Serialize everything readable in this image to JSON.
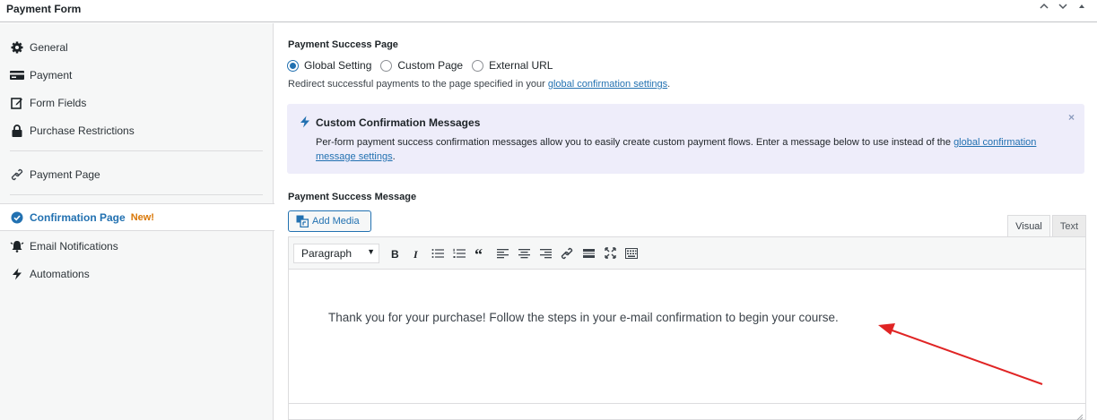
{
  "header": {
    "title": "Payment Form",
    "ctrl_up": "^",
    "ctrl_down": "v",
    "ctrl_collapse": "▴"
  },
  "sidebar": {
    "items": [
      {
        "label": "General",
        "icon": "gear-icon"
      },
      {
        "label": "Payment",
        "icon": "card-icon"
      },
      {
        "label": "Form Fields",
        "icon": "edit-icon"
      },
      {
        "label": "Purchase Restrictions",
        "icon": "lock-icon"
      },
      {
        "label": "Payment Page",
        "icon": "link-icon"
      },
      {
        "label": "Confirmation Page",
        "icon": "check-circle-icon",
        "badge": "New!",
        "active": true
      },
      {
        "label": "Email Notifications",
        "icon": "bell-icon"
      },
      {
        "label": "Automations",
        "icon": "bolt-icon"
      }
    ]
  },
  "success_page": {
    "label": "Payment Success Page",
    "options": [
      "Global Setting",
      "Custom Page",
      "External URL"
    ],
    "selected": "Global Setting",
    "help_prefix": "Redirect successful payments to the page specified in your ",
    "help_link": "global confirmation settings",
    "help_suffix": "."
  },
  "notice": {
    "title": "Custom Confirmation Messages",
    "body_prefix": "Per-form payment success confirmation messages allow you to easily create custom payment flows. Enter a message below to use instead of the ",
    "body_link": "global confirmation message settings",
    "body_suffix": ".",
    "close": "×"
  },
  "message": {
    "label": "Payment Success Message",
    "add_media": "Add Media",
    "tab_visual": "Visual",
    "tab_text": "Text",
    "format": "Paragraph",
    "content": "Thank you for your purchase! Follow the steps in your e-mail confirmation to begin your course."
  },
  "colors": {
    "accent": "#2271b1",
    "badge": "#d97706",
    "notice_bg": "#eeedfa",
    "arrow": "#e02424"
  }
}
